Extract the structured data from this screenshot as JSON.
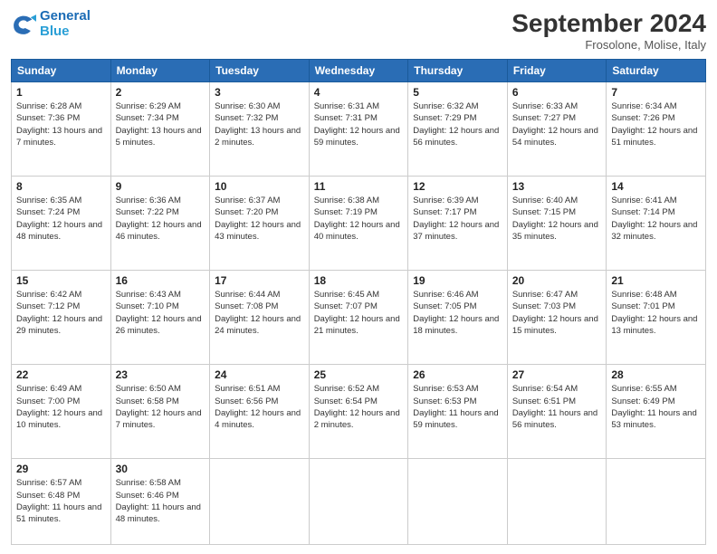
{
  "header": {
    "logo_general": "General",
    "logo_blue": "Blue",
    "month": "September 2024",
    "location": "Frosolone, Molise, Italy"
  },
  "days_of_week": [
    "Sunday",
    "Monday",
    "Tuesday",
    "Wednesday",
    "Thursday",
    "Friday",
    "Saturday"
  ],
  "weeks": [
    [
      {
        "day": "1",
        "sunrise": "Sunrise: 6:28 AM",
        "sunset": "Sunset: 7:36 PM",
        "daylight": "Daylight: 13 hours and 7 minutes."
      },
      {
        "day": "2",
        "sunrise": "Sunrise: 6:29 AM",
        "sunset": "Sunset: 7:34 PM",
        "daylight": "Daylight: 13 hours and 5 minutes."
      },
      {
        "day": "3",
        "sunrise": "Sunrise: 6:30 AM",
        "sunset": "Sunset: 7:32 PM",
        "daylight": "Daylight: 13 hours and 2 minutes."
      },
      {
        "day": "4",
        "sunrise": "Sunrise: 6:31 AM",
        "sunset": "Sunset: 7:31 PM",
        "daylight": "Daylight: 12 hours and 59 minutes."
      },
      {
        "day": "5",
        "sunrise": "Sunrise: 6:32 AM",
        "sunset": "Sunset: 7:29 PM",
        "daylight": "Daylight: 12 hours and 56 minutes."
      },
      {
        "day": "6",
        "sunrise": "Sunrise: 6:33 AM",
        "sunset": "Sunset: 7:27 PM",
        "daylight": "Daylight: 12 hours and 54 minutes."
      },
      {
        "day": "7",
        "sunrise": "Sunrise: 6:34 AM",
        "sunset": "Sunset: 7:26 PM",
        "daylight": "Daylight: 12 hours and 51 minutes."
      }
    ],
    [
      {
        "day": "8",
        "sunrise": "Sunrise: 6:35 AM",
        "sunset": "Sunset: 7:24 PM",
        "daylight": "Daylight: 12 hours and 48 minutes."
      },
      {
        "day": "9",
        "sunrise": "Sunrise: 6:36 AM",
        "sunset": "Sunset: 7:22 PM",
        "daylight": "Daylight: 12 hours and 46 minutes."
      },
      {
        "day": "10",
        "sunrise": "Sunrise: 6:37 AM",
        "sunset": "Sunset: 7:20 PM",
        "daylight": "Daylight: 12 hours and 43 minutes."
      },
      {
        "day": "11",
        "sunrise": "Sunrise: 6:38 AM",
        "sunset": "Sunset: 7:19 PM",
        "daylight": "Daylight: 12 hours and 40 minutes."
      },
      {
        "day": "12",
        "sunrise": "Sunrise: 6:39 AM",
        "sunset": "Sunset: 7:17 PM",
        "daylight": "Daylight: 12 hours and 37 minutes."
      },
      {
        "day": "13",
        "sunrise": "Sunrise: 6:40 AM",
        "sunset": "Sunset: 7:15 PM",
        "daylight": "Daylight: 12 hours and 35 minutes."
      },
      {
        "day": "14",
        "sunrise": "Sunrise: 6:41 AM",
        "sunset": "Sunset: 7:14 PM",
        "daylight": "Daylight: 12 hours and 32 minutes."
      }
    ],
    [
      {
        "day": "15",
        "sunrise": "Sunrise: 6:42 AM",
        "sunset": "Sunset: 7:12 PM",
        "daylight": "Daylight: 12 hours and 29 minutes."
      },
      {
        "day": "16",
        "sunrise": "Sunrise: 6:43 AM",
        "sunset": "Sunset: 7:10 PM",
        "daylight": "Daylight: 12 hours and 26 minutes."
      },
      {
        "day": "17",
        "sunrise": "Sunrise: 6:44 AM",
        "sunset": "Sunset: 7:08 PM",
        "daylight": "Daylight: 12 hours and 24 minutes."
      },
      {
        "day": "18",
        "sunrise": "Sunrise: 6:45 AM",
        "sunset": "Sunset: 7:07 PM",
        "daylight": "Daylight: 12 hours and 21 minutes."
      },
      {
        "day": "19",
        "sunrise": "Sunrise: 6:46 AM",
        "sunset": "Sunset: 7:05 PM",
        "daylight": "Daylight: 12 hours and 18 minutes."
      },
      {
        "day": "20",
        "sunrise": "Sunrise: 6:47 AM",
        "sunset": "Sunset: 7:03 PM",
        "daylight": "Daylight: 12 hours and 15 minutes."
      },
      {
        "day": "21",
        "sunrise": "Sunrise: 6:48 AM",
        "sunset": "Sunset: 7:01 PM",
        "daylight": "Daylight: 12 hours and 13 minutes."
      }
    ],
    [
      {
        "day": "22",
        "sunrise": "Sunrise: 6:49 AM",
        "sunset": "Sunset: 7:00 PM",
        "daylight": "Daylight: 12 hours and 10 minutes."
      },
      {
        "day": "23",
        "sunrise": "Sunrise: 6:50 AM",
        "sunset": "Sunset: 6:58 PM",
        "daylight": "Daylight: 12 hours and 7 minutes."
      },
      {
        "day": "24",
        "sunrise": "Sunrise: 6:51 AM",
        "sunset": "Sunset: 6:56 PM",
        "daylight": "Daylight: 12 hours and 4 minutes."
      },
      {
        "day": "25",
        "sunrise": "Sunrise: 6:52 AM",
        "sunset": "Sunset: 6:54 PM",
        "daylight": "Daylight: 12 hours and 2 minutes."
      },
      {
        "day": "26",
        "sunrise": "Sunrise: 6:53 AM",
        "sunset": "Sunset: 6:53 PM",
        "daylight": "Daylight: 11 hours and 59 minutes."
      },
      {
        "day": "27",
        "sunrise": "Sunrise: 6:54 AM",
        "sunset": "Sunset: 6:51 PM",
        "daylight": "Daylight: 11 hours and 56 minutes."
      },
      {
        "day": "28",
        "sunrise": "Sunrise: 6:55 AM",
        "sunset": "Sunset: 6:49 PM",
        "daylight": "Daylight: 11 hours and 53 minutes."
      }
    ],
    [
      {
        "day": "29",
        "sunrise": "Sunrise: 6:57 AM",
        "sunset": "Sunset: 6:48 PM",
        "daylight": "Daylight: 11 hours and 51 minutes."
      },
      {
        "day": "30",
        "sunrise": "Sunrise: 6:58 AM",
        "sunset": "Sunset: 6:46 PM",
        "daylight": "Daylight: 11 hours and 48 minutes."
      },
      null,
      null,
      null,
      null,
      null
    ]
  ]
}
